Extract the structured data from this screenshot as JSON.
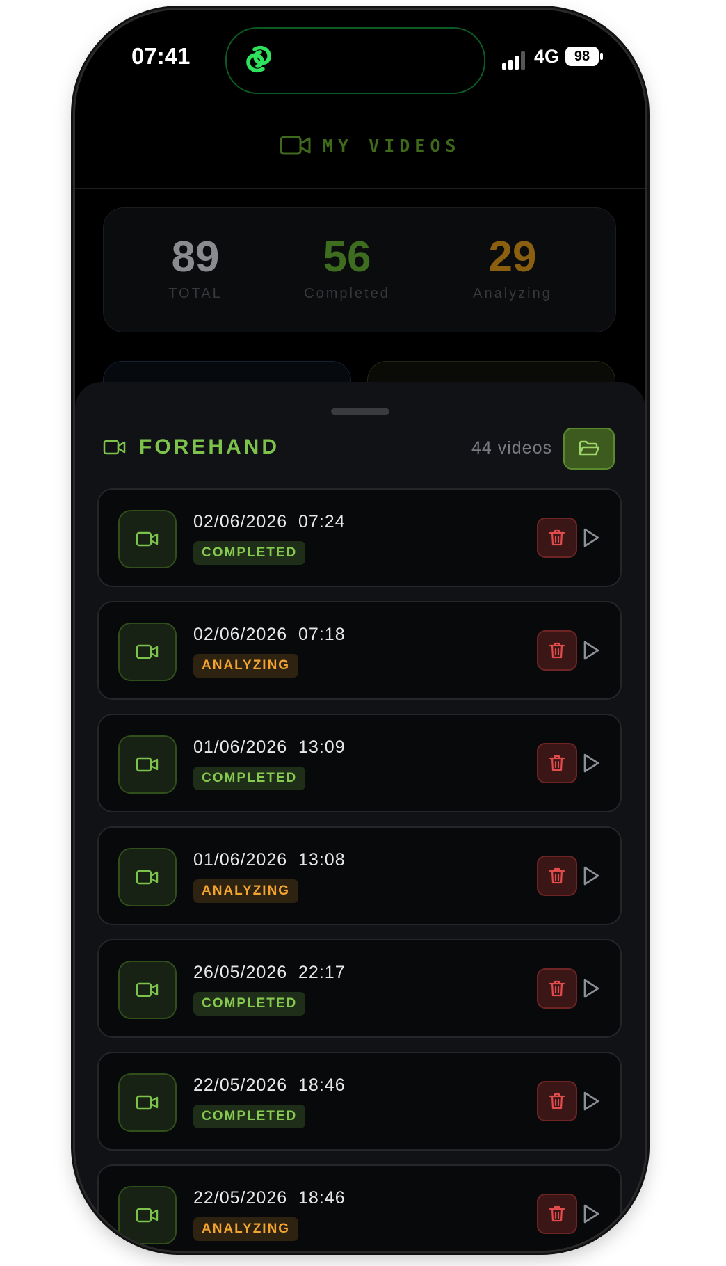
{
  "status_bar": {
    "time": "07:41",
    "network": "4G",
    "battery": "98"
  },
  "header": {
    "title": "MY VIDEOS",
    "icon": "video-camera-icon"
  },
  "stats": [
    {
      "value": "89",
      "label": "TOTAL",
      "color": "#8a8b8e"
    },
    {
      "value": "56",
      "label": "Completed",
      "color": "#3f6d1f"
    },
    {
      "value": "29",
      "label": "Analyzing",
      "color": "#8a5f10"
    }
  ],
  "section": {
    "title": "FOREHAND",
    "count": "44 videos",
    "folder_icon": "folder-open-icon"
  },
  "videos": [
    {
      "date": "02/06/2026",
      "time": "07:24",
      "status": "COMPLETED"
    },
    {
      "date": "02/06/2026",
      "time": "07:18",
      "status": "ANALYZING"
    },
    {
      "date": "01/06/2026",
      "time": "13:09",
      "status": "COMPLETED"
    },
    {
      "date": "01/06/2026",
      "time": "13:08",
      "status": "ANALYZING"
    },
    {
      "date": "26/05/2026",
      "time": "22:17",
      "status": "COMPLETED"
    },
    {
      "date": "22/05/2026",
      "time": "18:46",
      "status": "COMPLETED"
    },
    {
      "date": "22/05/2026",
      "time": "18:46",
      "status": "ANALYZING"
    }
  ],
  "colors": {
    "accent_green": "#7dc24a",
    "completed": "#86c94f",
    "analyzing": "#f2a330",
    "delete": "#e04b4b"
  }
}
